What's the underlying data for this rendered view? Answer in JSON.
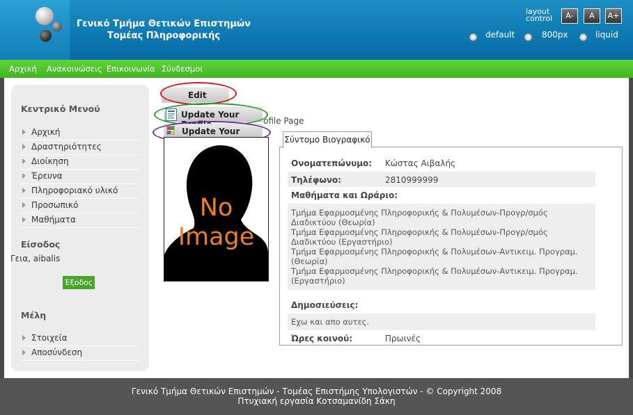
{
  "header": {
    "title_line1": "Γενικό Τμήμα Θετικών Επιστημών",
    "title_line2": "Τομέας Πληροφορικής",
    "layout_control_line1": "layout",
    "layout_control_line2": "control",
    "font_buttons": [
      "A-",
      "A",
      "A+"
    ],
    "layout_options": [
      "default",
      "800px",
      "liquid"
    ]
  },
  "nav": {
    "items": [
      "Αρχική",
      "Ανακοινώσεις",
      "Επικοινωνία",
      "Σύνδεσμοι"
    ]
  },
  "sidebar": {
    "main_menu_heading": "Κεντρικό Μενού",
    "main_menu_items": [
      "Αρχική",
      "Δραστηριότητες",
      "Διοίκηση",
      "Έρευνα",
      "Πληροφοριακό υλικό",
      "Προσωπικό",
      "Μαθήματα"
    ],
    "login_heading": "Είσοδος",
    "greeting": "Γεια, aibalis",
    "logout_label": "Έξοδος",
    "members_heading": "Μέλη",
    "members_items": [
      "Στοιχεία",
      "Αποσύνδεση"
    ]
  },
  "actions": {
    "edit_label": "Edit",
    "update_profile_label": "Update Your Profile",
    "update_image_label": "Update Your Image",
    "profile_page_partial": "ofile Page"
  },
  "photo": {
    "no_image_line1": "No",
    "no_image_line2": "Image"
  },
  "cv": {
    "tab_label": "Σύντομο Βιογραφικό",
    "name_label": "Ονοματεπώνυμο:",
    "name_value": "Κώστας Αιβαλής",
    "phone_label": "Τηλέφωνο:",
    "phone_value": "2810999999",
    "courses_label": "Μαθήματα και Ωράριο:",
    "courses": [
      "Τμήμα Εφαρμοσμένης Πληροφορικής & Πολυμέσων-Προγρ/σμός Διαδικτύου (Θεωρία)",
      "Τμήμα Εφαρμοσμένης Πληροφορικής & Πολυμέσων-Προγρ/σμός Διαδικτύου (Εργαστήριο)",
      "Τμήμα Εφαρμοσμένης Πληροφορικής & Πολυμέσων-Αντικειμ. Προγραμ. (Θεωρία)",
      "Τμήμα Εφαρμοσμένης Πληροφορικής & Πολυμέσων-Αντικειμ. Προγραμ. (Εργαστήριο)"
    ],
    "publications_label": "Δημοσιεύσεις:",
    "publications_value": "Εχω και απο αυτες.",
    "hours_label": "Ώρες κοινού:",
    "hours_value": "Πρωινές"
  },
  "footer": {
    "line1": "Γενικό Τμήμα Θετικών Επιστημών - Τομέας Επιστήμης Υπολογιστών - © Copyright 2008",
    "line2": "Πτυχιακή εργασία Κοτσαμανίδη Σάκη"
  },
  "colors": {
    "header_blue": "#0f7ab3",
    "nav_green": "#4cc028",
    "edit_oval": "#e0141e",
    "profile_oval": "#1fa02a",
    "image_oval": "#6a2f93",
    "no_image_orange": "#f07f24"
  }
}
